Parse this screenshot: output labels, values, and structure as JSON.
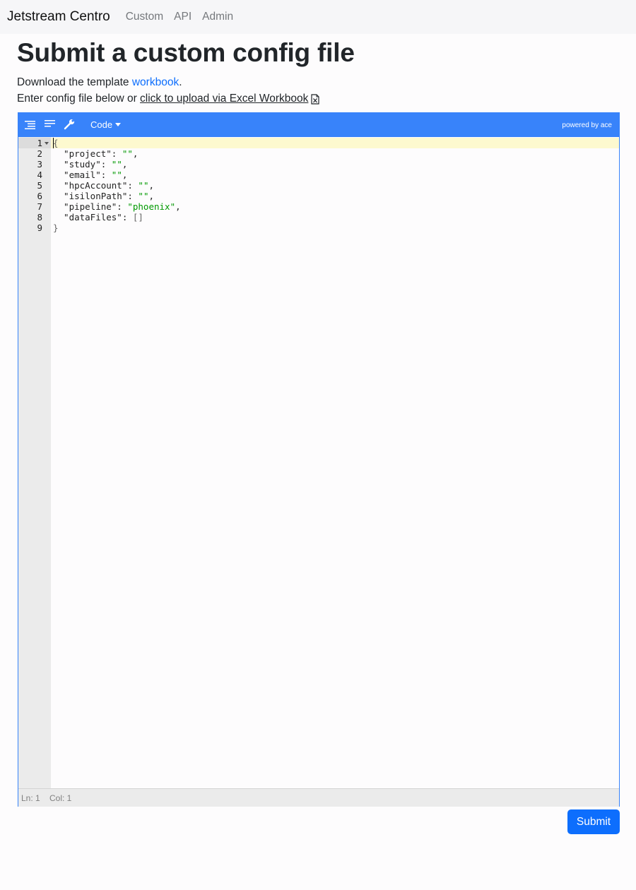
{
  "navbar": {
    "brand": "Jetstream Centro",
    "links": [
      "Custom",
      "API",
      "Admin"
    ]
  },
  "page": {
    "title": "Submit a custom config file",
    "download_prefix": "Download the template ",
    "download_link": "workbook",
    "download_suffix": ".",
    "enter_prefix": "Enter config file below or ",
    "upload_link": "click to upload via Excel Workbook"
  },
  "editor": {
    "mode_label": "Code",
    "powered_by": "powered by ace",
    "toolbar_icons": [
      "format-icon",
      "compact-icon",
      "repair-icon"
    ],
    "line_numbers": [
      "1",
      "2",
      "3",
      "4",
      "5",
      "6",
      "7",
      "8",
      "9"
    ],
    "lines": [
      [
        {
          "t": "{",
          "c": "brk"
        }
      ],
      [
        {
          "t": "  \"project\": ",
          "c": ""
        },
        {
          "t": "\"\"",
          "c": "str"
        },
        {
          "t": ",",
          "c": ""
        }
      ],
      [
        {
          "t": "  \"study\": ",
          "c": ""
        },
        {
          "t": "\"\"",
          "c": "str"
        },
        {
          "t": ",",
          "c": ""
        }
      ],
      [
        {
          "t": "  \"email\": ",
          "c": ""
        },
        {
          "t": "\"\"",
          "c": "str"
        },
        {
          "t": ",",
          "c": ""
        }
      ],
      [
        {
          "t": "  \"hpcAccount\": ",
          "c": ""
        },
        {
          "t": "\"\"",
          "c": "str"
        },
        {
          "t": ",",
          "c": ""
        }
      ],
      [
        {
          "t": "  \"isilonPath\": ",
          "c": ""
        },
        {
          "t": "\"\"",
          "c": "str"
        },
        {
          "t": ",",
          "c": ""
        }
      ],
      [
        {
          "t": "  \"pipeline\": ",
          "c": ""
        },
        {
          "t": "\"phoenix\"",
          "c": "str"
        },
        {
          "t": ",",
          "c": ""
        }
      ],
      [
        {
          "t": "  \"dataFiles\": ",
          "c": ""
        },
        {
          "t": "[]",
          "c": "brk"
        }
      ],
      [
        {
          "t": "}",
          "c": "brk"
        }
      ]
    ],
    "status_ln": "Ln: 1",
    "status_col": "Col: 1"
  },
  "submit_label": "Submit",
  "colors": {
    "accent": "#3883fa",
    "primary_button": "#0d6efd",
    "string": "#009900",
    "active_line": "#fdf9cf"
  }
}
